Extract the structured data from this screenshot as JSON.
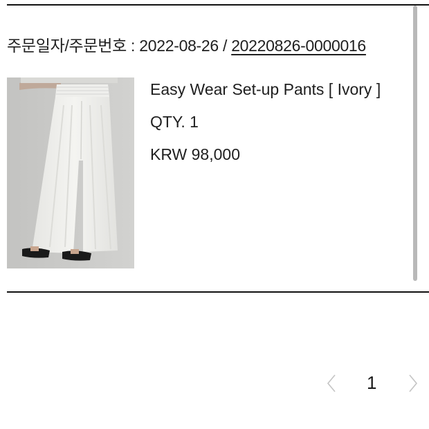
{
  "order": {
    "label": "주문일자/주문번호 : ",
    "date": "2022-08-26",
    "separator": " / ",
    "number": "20220826-0000016"
  },
  "product": {
    "name": "Easy Wear Set-up Pants [ Ivory ]",
    "qty": "QTY. 1",
    "price": "KRW 98,000",
    "image_icon": "product-photo-white-pants"
  },
  "pagination": {
    "current": "1",
    "prev_icon": "chevron-left-icon",
    "next_icon": "chevron-right-icon"
  },
  "colors": {
    "rule": "#111111",
    "text": "#1f1f1f",
    "chevron": "#c4c4c4",
    "image_bg": "#c9c9c7"
  }
}
